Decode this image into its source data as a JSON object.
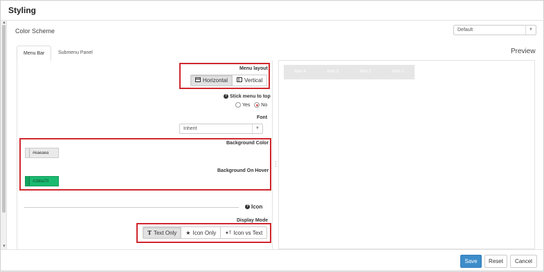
{
  "dialog": {
    "title": "Styling"
  },
  "color_scheme": {
    "label": "Color Scheme",
    "value": "Default"
  },
  "tabs": [
    {
      "label": "Menu Bar",
      "active": true
    },
    {
      "label": "Submenu Panel",
      "active": false
    }
  ],
  "preview": {
    "title": "Preview",
    "menu_items": [
      "Item 4",
      "Item 3",
      "Item 2",
      "Item 1"
    ]
  },
  "menu_layout": {
    "label": "Menu layout",
    "options": [
      "Horizontal",
      "Vertical"
    ],
    "selected": "Horizontal"
  },
  "stick_menu": {
    "label": "Stick menu to top",
    "yes": "Yes",
    "no": "No",
    "selected": "No"
  },
  "font": {
    "label": "Font",
    "value": "Inherit"
  },
  "background_color": {
    "label": "Background Color",
    "value": "#eaeaea",
    "color": "#eaeaea"
  },
  "background_hover": {
    "label": "Background On Hover",
    "value": "#1bba70",
    "color": "#1bba70"
  },
  "icon_section": {
    "label": "Icon"
  },
  "display_mode": {
    "label": "Display Mode",
    "options": [
      "Text Only",
      "Icon Only",
      "Icon vs Text"
    ],
    "selected": "Text Only"
  },
  "footer": {
    "save": "Save",
    "reset": "Reset",
    "cancel": "Cancel"
  },
  "colors": {
    "primary": "#3c8dca",
    "highlight": "#d0262d",
    "hover_green": "#1bba70"
  }
}
